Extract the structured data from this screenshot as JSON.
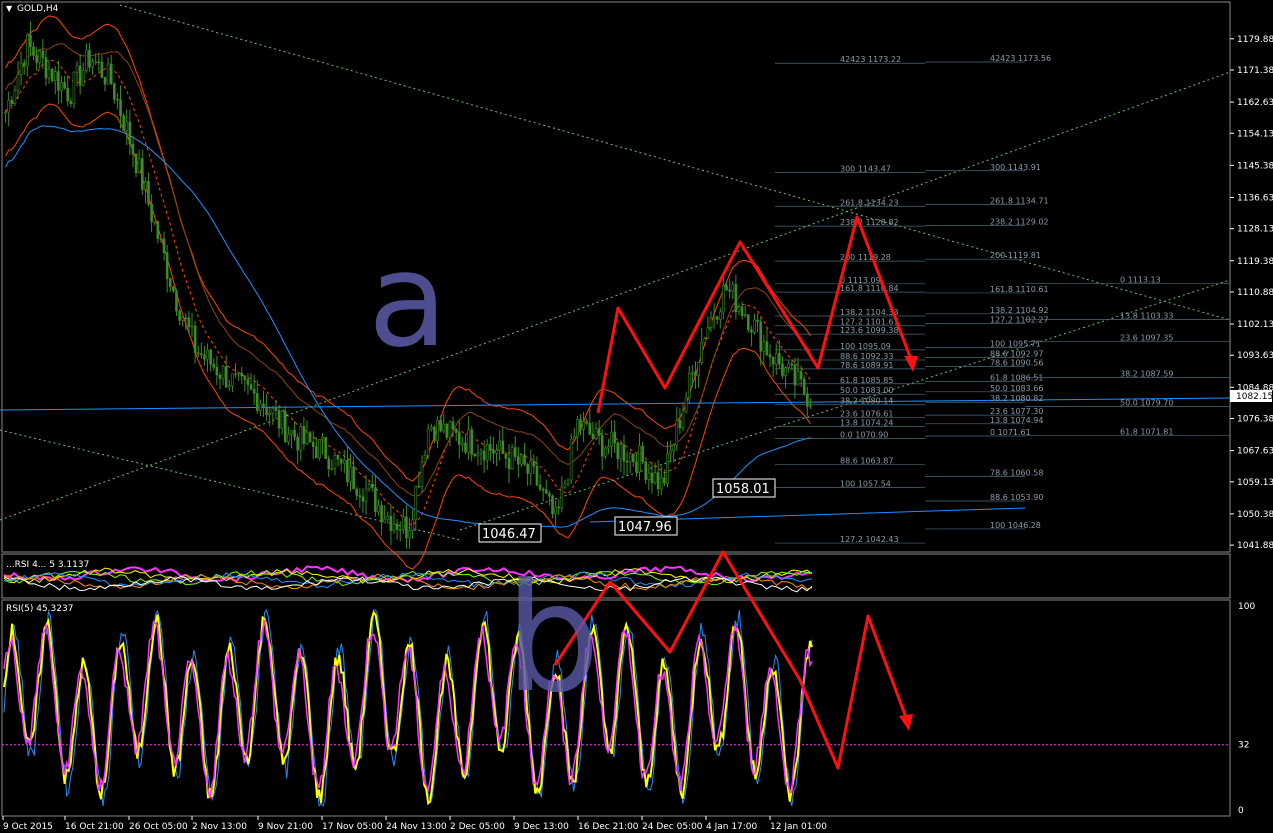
{
  "symbol_title": "GOLD,H4",
  "rsi_title": "RSI(5) 45.3237",
  "indicator_title": "...RSI 4... 5 3.1137",
  "current_price": "1082.15",
  "price_axis": [
    "1179.88",
    "1171.38",
    "1162.63",
    "1154.13",
    "1145.38",
    "1136.63",
    "1128.13",
    "1119.38",
    "1110.88",
    "1102.13",
    "1093.63",
    "1084.88",
    "1076.38",
    "1067.63",
    "1059.13",
    "1050.38",
    "1041.88"
  ],
  "rsi_axis": [
    "100",
    "32",
    "0"
  ],
  "time_axis": [
    "9 Oct 2015",
    "16 Oct 21:00",
    "26 Oct 05:00",
    "2 Nov 13:00",
    "9 Nov 21:00",
    "17 Nov 05:00",
    "24 Nov 13:00",
    "2 Dec 05:00",
    "9 Dec 13:00",
    "16 Dec 21:00",
    "24 Dec 05:00",
    "4 Jan 17:00",
    "12 Jan 01:00"
  ],
  "swing_labels": {
    "low1": "1046.47",
    "low2": "1047.96",
    "low3": "1058.01"
  },
  "annotations": {
    "wave_a": "a",
    "wave_b": "b"
  },
  "fib_labels": {
    "set1": [
      "42423 1173.22",
      "300 1143.47",
      "261.8 1134.23",
      "238.2 1128.82",
      "200 1119.28",
      "0 1113.09",
      "161.8 1110.84",
      "138.2 1104.33",
      "127.2 1101.67",
      "123.6 1099.38",
      "100 1095.09",
      "88.6 1092.33",
      "78.6 1089.91",
      "61.8 1085.85",
      "50.0 1083.00",
      "38.2 1080.14",
      "23.6 1076.61",
      "13.8 1074.24",
      "0.0 1070.90",
      "88.6 1063.87",
      "100 1057.54",
      "127.2 1042.43"
    ],
    "set2": [
      "42423 1173.56",
      "300 1143.91",
      "261.8 1134.71",
      "238.2 1129.02",
      "200 1119.81",
      "161.8 1110.61",
      "138.2 1104.92",
      "127.2 1102.27",
      "100 1095.71",
      "88.6 1092.97",
      "78.6 1090.56",
      "61.8 1086.51",
      "50.0 1083.66",
      "38.2 1080.82",
      "23.6 1077.30",
      "13.8 1074.94",
      "0 1071.61",
      "78.6 1060.58",
      "88.6 1053.90",
      "100 1046.28"
    ],
    "set3": [
      "0 1113.13",
      "13.8 1103.33",
      "23.6 1097.35",
      "38.2 1087.59",
      "50.0 1079.70",
      "61.8 1071.81"
    ]
  },
  "colors": {
    "background": "#000000",
    "candle": "#3c8c28",
    "arrow": "#ff1010",
    "marker": "#5a5aa8",
    "ma_blue": "#1e90ff",
    "trend_green": "#6fc06f",
    "rsi_yellow": "#ffff00",
    "rsi_magenta": "#ff33ff",
    "band_red": "#ff4500",
    "axis_text": "#ffffff"
  },
  "chart_data": [
    {
      "type": "candlestick",
      "title": "GOLD,H4",
      "ylim": [
        1040,
        1185
      ],
      "x_ticks": [
        "9 Oct 2015",
        "16 Oct 21:00",
        "26 Oct 05:00",
        "2 Nov 13:00",
        "9 Nov 21:00",
        "17 Nov 05:00",
        "24 Nov 13:00",
        "2 Dec 05:00",
        "9 Dec 13:00",
        "16 Dec 21:00",
        "24 Dec 05:00",
        "4 Jan 17:00",
        "12 Jan 01:00"
      ],
      "price_path_anchors": [
        1160,
        1178,
        1172,
        1165,
        1175,
        1168,
        1150,
        1130,
        1110,
        1095,
        1090,
        1085,
        1082,
        1075,
        1070,
        1068,
        1062,
        1057,
        1050,
        1046.5,
        1075,
        1072,
        1070,
        1068,
        1065,
        1060,
        1047.96,
        1075,
        1070,
        1068,
        1065,
        1058.01,
        1080,
        1100,
        1112,
        1105,
        1095,
        1088,
        1082.15
      ],
      "swing_lows": [
        1046.47,
        1047.96,
        1058.01
      ],
      "current_price": 1082.15
    },
    {
      "type": "line",
      "title": "RSI(5) 45.3237",
      "ylim": [
        0,
        100
      ],
      "level": 32,
      "last_value": 45.3237
    }
  ]
}
